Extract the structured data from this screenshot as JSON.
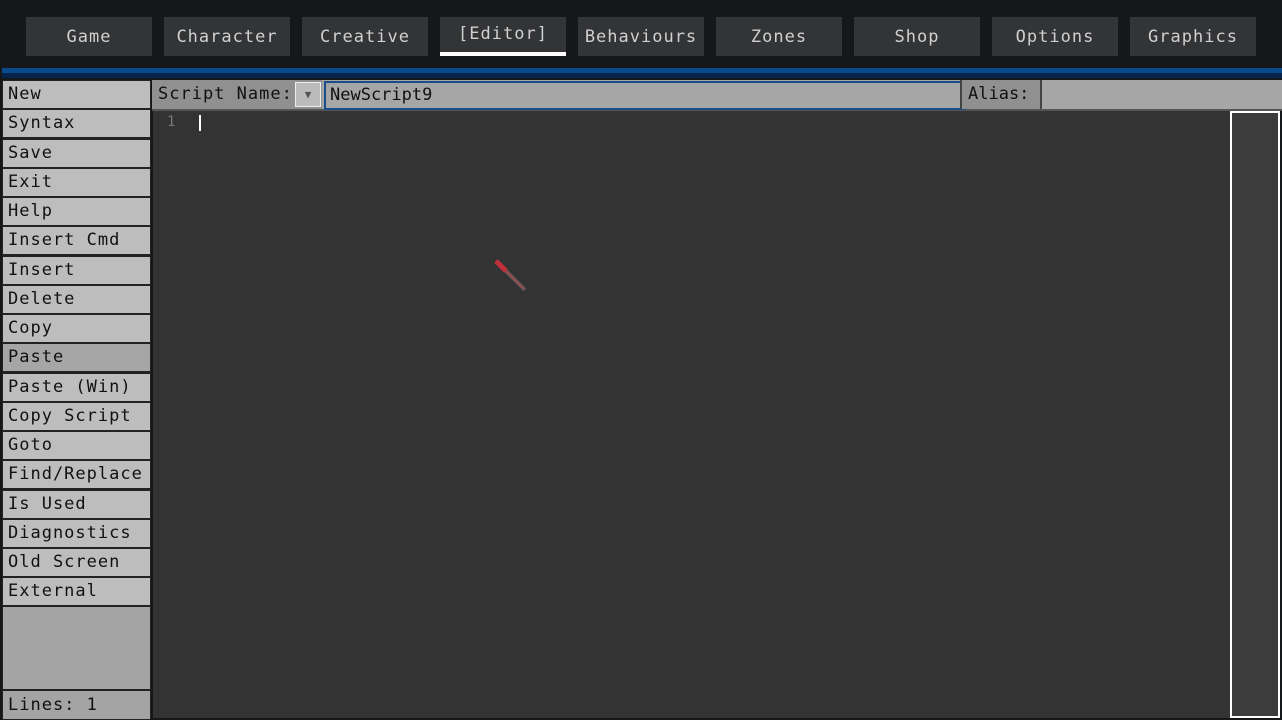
{
  "tabs": [
    {
      "label": "Game"
    },
    {
      "label": "Character"
    },
    {
      "label": "Creative"
    },
    {
      "label": "[Editor]",
      "active": true
    },
    {
      "label": "Behaviours"
    },
    {
      "label": "Zones"
    },
    {
      "label": "Shop"
    },
    {
      "label": "Options"
    },
    {
      "label": "Graphics"
    }
  ],
  "sidebar": {
    "items": [
      {
        "label": "New"
      },
      {
        "label": "Syntax"
      },
      {
        "label": "Save"
      },
      {
        "label": "Exit"
      },
      {
        "label": "Help"
      },
      {
        "label": "Insert Cmd"
      },
      {
        "label": "Insert"
      },
      {
        "label": "Delete"
      },
      {
        "label": "Copy"
      },
      {
        "label": "Paste",
        "highlighted": true
      },
      {
        "label": "Paste (Win)"
      },
      {
        "label": "Copy Script"
      },
      {
        "label": "Goto"
      },
      {
        "label": "Find/Replace"
      },
      {
        "label": "Is Used"
      },
      {
        "label": "Diagnostics"
      },
      {
        "label": "Old Screen"
      },
      {
        "label": "External"
      }
    ],
    "lines_label": "Lines: 1"
  },
  "header": {
    "script_name_label": "Script Name:",
    "script_name_value": "NewScript9",
    "alias_label": "Alias:",
    "alias_value": "",
    "dropdown_icon": "triangle-down-icon"
  },
  "editor": {
    "line_numbers": [
      "1"
    ],
    "content": ""
  },
  "colors": {
    "accent": "#0a4a8f",
    "tab_bg": "#333436",
    "editor_bg": "#333333"
  }
}
